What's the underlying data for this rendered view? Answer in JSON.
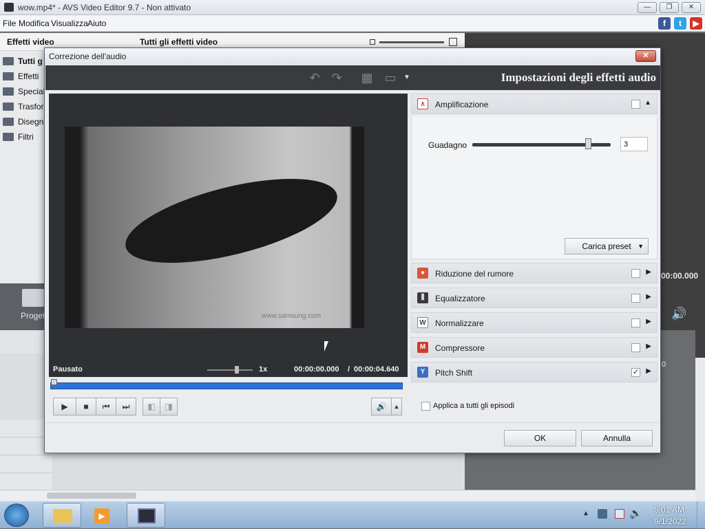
{
  "app": {
    "title": "wow.mp4* - AVS Video Editor 9.7 - Non attivato",
    "menu": [
      "File",
      "Modifica",
      "Visualizza",
      "Aiuto"
    ],
    "window_buttons": {
      "minimize": "—",
      "restore": "❐",
      "close": "✕"
    }
  },
  "left_panel": {
    "header": "Effetti video",
    "items": [
      "Tutti g",
      "Effetti",
      "Speciali",
      "Trasfor",
      "Disegno",
      "Filtri"
    ]
  },
  "content_header": "Tutti gli effetti video",
  "background": {
    "progetto_label": "Progett",
    "timecode": "00:00.000",
    "timeline_tick": "0"
  },
  "dialog": {
    "title": "Correzione dell'audio",
    "close": "✕",
    "toolbar_header": "Impostazioni degli effetti audio",
    "player": {
      "status": "Pausato",
      "speed": "1x",
      "current_time": "00:00:00.000",
      "separator": "/",
      "total_time": "00:00:04.640",
      "watermark": "www.samsung.com",
      "seek_progress": 0.0
    },
    "effects": {
      "amplification": {
        "label": "Amplificazione",
        "checked": false,
        "gain_label": "Guadagno",
        "gain_value": "3",
        "gain_level": 0.82,
        "preset_button": "Carica preset"
      },
      "list": [
        {
          "label": "Riduzione del rumore",
          "checked": false,
          "icon": "noise-icon",
          "color": "#d5573c"
        },
        {
          "label": "Equalizzatore",
          "checked": false,
          "icon": "equalizer-icon",
          "color": "#3a3a3a"
        },
        {
          "label": "Normalizzare",
          "checked": false,
          "icon": "normalize-icon",
          "color": "#4d4d4d"
        },
        {
          "label": "Compressore",
          "checked": false,
          "icon": "compressor-icon",
          "color": "#cf3b2a"
        },
        {
          "label": "Pitch Shift",
          "checked": true,
          "icon": "pitch-icon",
          "color": "#3a6fbf"
        }
      ]
    },
    "apply_all_label": "Applica a tutti gli episodi",
    "ok_button": "OK",
    "cancel_button": "Annulla"
  },
  "taskbar": {
    "time": "5:01 AM",
    "date": "9/1/2022"
  }
}
